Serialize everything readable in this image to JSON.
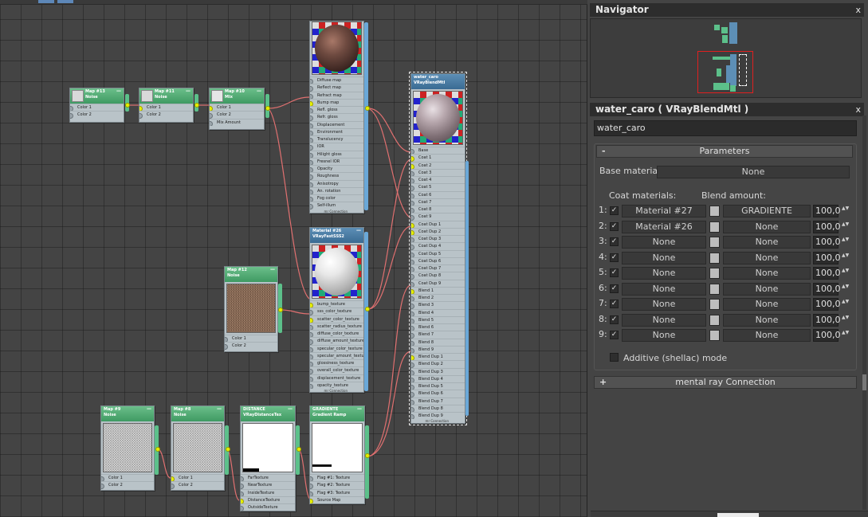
{
  "navigator": {
    "title": "Navigator",
    "close_glyph": "x"
  },
  "editor": {
    "title": "water_caro  ( VRayBlendMtl )",
    "close_glyph": "x",
    "name_value": "water_caro",
    "parameters": {
      "header": "Parameters",
      "collapse_sign": "-",
      "base_label": "Base material:",
      "base_value": "None",
      "coat_label": "Coat materials:",
      "blend_label": "Blend amount:",
      "rows": [
        {
          "index": "1:",
          "material": "Material #27",
          "blend": "GRADIENTE",
          "amount": "100,0"
        },
        {
          "index": "2:",
          "material": "Material #26",
          "blend": "None",
          "amount": "100,0"
        },
        {
          "index": "3:",
          "material": "None",
          "blend": "None",
          "amount": "100,0"
        },
        {
          "index": "4:",
          "material": "None",
          "blend": "None",
          "amount": "100,0"
        },
        {
          "index": "5:",
          "material": "None",
          "blend": "None",
          "amount": "100,0"
        },
        {
          "index": "6:",
          "material": "None",
          "blend": "None",
          "amount": "100,0"
        },
        {
          "index": "7:",
          "material": "None",
          "blend": "None",
          "amount": "100,0"
        },
        {
          "index": "8:",
          "material": "None",
          "blend": "None",
          "amount": "100,0"
        },
        {
          "index": "9:",
          "material": "None",
          "blend": "None",
          "amount": "100,0"
        }
      ],
      "additive_label": "Additive (shellac) mode",
      "check_glyph": "✓",
      "spin_glyph": "▲▼"
    },
    "mr_connection": {
      "label": "mental ray Connection",
      "expand_sign": "+"
    }
  },
  "nodes": {
    "map13": {
      "title": "Map #13",
      "type": "Noise",
      "slots": [
        "Color 1",
        "Color 2"
      ]
    },
    "map11": {
      "title": "Map #11",
      "type": "Noise",
      "slots": [
        "Color 1",
        "Color 2"
      ]
    },
    "map10": {
      "title": "Map #10",
      "type": "Mix",
      "slots": [
        "Color 1",
        "Color 2",
        "Mix Amount"
      ]
    },
    "mat27": {
      "slots": [
        "Diffuse map",
        "Reflect map",
        "Refract map",
        "Bump map",
        "Refl. gloss",
        "Refr. gloss",
        "Displacement",
        "Environment",
        "Translucency",
        "IOR",
        "Hilight gloss",
        "Fresnel IOR",
        "Opacity",
        "Roughness",
        "Anisotropy",
        "An. rotation",
        "Fog color",
        "Self-illum"
      ],
      "footer": "mr Connection"
    },
    "water": {
      "title": "water_caro",
      "type": "VRayBlendMtl",
      "slots": [
        "Base",
        "Coat 1",
        "Coat 2",
        "Coat 3",
        "Coat 4",
        "Coat 5",
        "Coat 6",
        "Coat 7",
        "Coat 8",
        "Coat 9",
        "Coat Dup 1",
        "Coat Dup 2",
        "Coat Dup 3",
        "Coat Dup 4",
        "Coat Dup 5",
        "Coat Dup 6",
        "Coat Dup 7",
        "Coat Dup 8",
        "Coat Dup 9",
        "Blend 1",
        "Blend 2",
        "Blend 3",
        "Blend 4",
        "Blend 5",
        "Blend 6",
        "Blend 7",
        "Blend 8",
        "Blend 9",
        "Blend Dup 1",
        "Blend Dup 2",
        "Blend Dup 3",
        "Blend Dup 4",
        "Blend Dup 5",
        "Blend Dup 6",
        "Blend Dup 7",
        "Blend Dup 8",
        "Blend Dup 9"
      ],
      "footer": "mr Connection"
    },
    "mat26": {
      "title": "Material #26",
      "type": "VRayFastSSS2",
      "slots": [
        "bump_texture",
        "sss_color_texture",
        "scatter_color_texture",
        "scatter_radius_texture",
        "diffuse_color_texture",
        "diffuse_amount_texture",
        "specular_color_texture",
        "specular_amount_texture",
        "glossiness_texture",
        "overall_color_texture",
        "displacement_texture",
        "opacity_texture"
      ],
      "footer": "mr Connection"
    },
    "map12": {
      "title": "Map #12",
      "type": "Noise",
      "slots": [
        "Color 1",
        "Color 2"
      ]
    },
    "map9": {
      "title": "Map #9",
      "type": "Noise",
      "slots": [
        "Color 1",
        "Color 2"
      ]
    },
    "map8": {
      "title": "Map #8",
      "type": "Noise",
      "slots": [
        "Color 1",
        "Color 2"
      ]
    },
    "distance": {
      "title": "DISTANCE",
      "type": "VRayDistanceTex",
      "slots": [
        "FarTexture",
        "NearTexture",
        "InsideTexture",
        "DistanceTexture",
        "OutsideTexture"
      ]
    },
    "gradiente": {
      "title": "GRADIENTE",
      "type": "Gradient Ramp",
      "slots": [
        "Flag #1: Texture",
        "Flag #2: Texture",
        "Flag #3: Texture",
        "Source Map"
      ]
    }
  },
  "node_header_dash": "—"
}
